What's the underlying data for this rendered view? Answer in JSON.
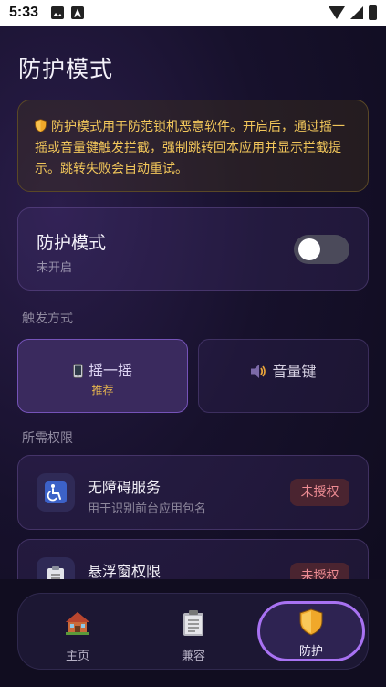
{
  "status_bar": {
    "time": "5:33"
  },
  "page": {
    "title": "防护模式"
  },
  "notice": {
    "text": "防护模式用于防范锁机恶意软件。开启后，通过摇一摇或音量键触发拦截，强制跳转回本应用并显示拦截提示。跳转失败会自动重试。"
  },
  "mode": {
    "title": "防护模式",
    "status": "未开启",
    "enabled": false
  },
  "trigger": {
    "section_label": "触发方式",
    "shake_label": "摇一摇",
    "shake_badge": "推荐",
    "volume_label": "音量键"
  },
  "permissions": {
    "section_label": "所需权限",
    "items": [
      {
        "title": "无障碍服务",
        "subtitle": "用于识别前台应用包名",
        "status": "未授权",
        "icon": "accessibility-icon"
      },
      {
        "title": "悬浮窗权限",
        "status": "未授权",
        "icon": "clipboard-icon"
      }
    ]
  },
  "nav": {
    "items": [
      {
        "label": "主页",
        "icon": "house-icon"
      },
      {
        "label": "兼容",
        "icon": "clipboard-icon"
      },
      {
        "label": "防护",
        "icon": "shield-icon",
        "active": true
      }
    ]
  },
  "colors": {
    "accent": "#a872f2",
    "warning": "#f1c65a",
    "badge_bg": "#4a2430",
    "badge_text": "#ee8c93"
  }
}
